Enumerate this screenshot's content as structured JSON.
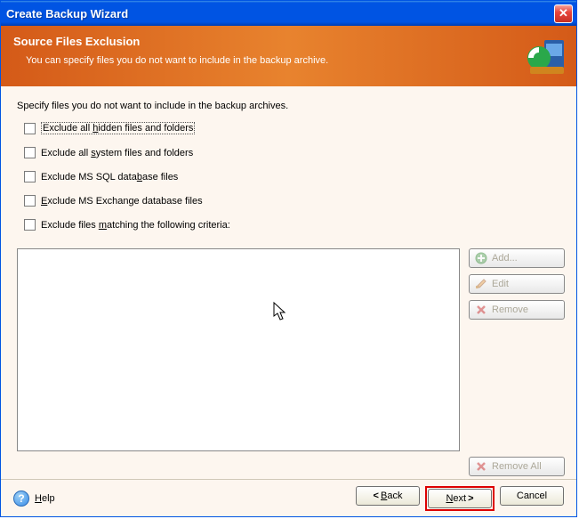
{
  "window": {
    "title": "Create Backup Wizard"
  },
  "header": {
    "title": "Source Files Exclusion",
    "subtitle": "You can specify files you do not want to include in the backup archive."
  },
  "content": {
    "intro": "Specify files you do not want to include in the backup archives.",
    "checkboxes": [
      {
        "label": "Exclude all hidden files and folders",
        "accel": "h",
        "focused": true
      },
      {
        "label": "Exclude all system files and folders",
        "accel": "s"
      },
      {
        "label": "Exclude MS SQL database files",
        "accel": "b"
      },
      {
        "label": "Exclude MS Exchange database files",
        "accel": "E"
      },
      {
        "label": "Exclude files matching the following criteria:",
        "accel": "m"
      }
    ]
  },
  "side": {
    "add": "Add...",
    "edit": "Edit",
    "remove": "Remove",
    "remove_all": "Remove All"
  },
  "footer": {
    "help": "Help",
    "back": "Back",
    "next": "Next",
    "cancel": "Cancel"
  }
}
